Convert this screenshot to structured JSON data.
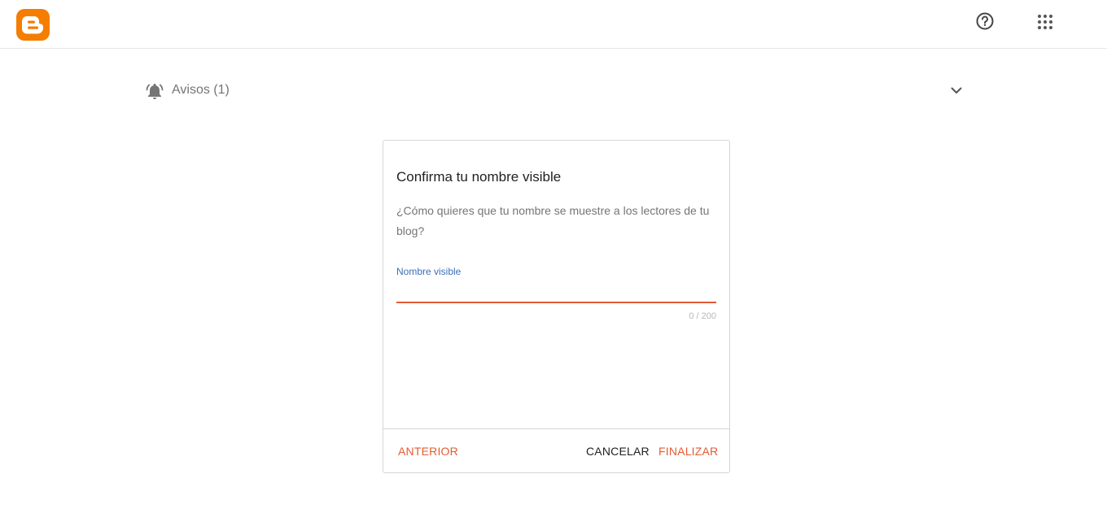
{
  "header": {
    "logo_icon": "blogger-logo-icon",
    "brand_color": "#f57d00",
    "help_icon": "help-circle-icon",
    "apps_icon": "apps-grid-icon"
  },
  "notices": {
    "icon": "bell-ring-icon",
    "label": "Avisos (1)",
    "expand_icon": "chevron-down-icon"
  },
  "dialog": {
    "title": "Confirma tu nombre visible",
    "description": "¿Cómo quieres que tu nombre se muestre a los lectores de tu blog?",
    "field": {
      "label": "Nombre visible",
      "value": "",
      "counter": "0 / 200"
    },
    "buttons": {
      "previous": "ANTERIOR",
      "cancel": "CANCELAR",
      "finish": "FINALIZAR"
    },
    "accent_color": "#e45b34",
    "label_color": "#3d6eb9"
  }
}
